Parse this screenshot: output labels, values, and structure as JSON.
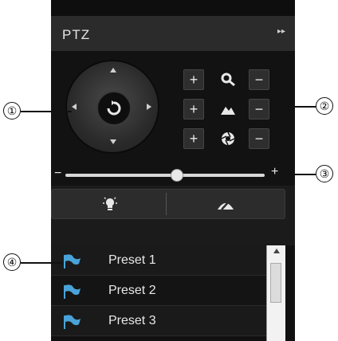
{
  "panel": {
    "title": "PTZ",
    "collapse_symbol": "▸▸"
  },
  "controls": {
    "zoom": {
      "plus": "+",
      "minus": "−",
      "icon": "zoom-magnifier-icon"
    },
    "focus": {
      "plus": "+",
      "minus": "−",
      "icon": "focus-mountain-icon"
    },
    "iris": {
      "plus": "+",
      "minus": "−",
      "icon": "iris-icon"
    }
  },
  "speed_slider": {
    "minus": "−",
    "plus": "+",
    "value_fraction": 0.56
  },
  "buttons": {
    "light_icon": "light-bulb-icon",
    "wiper_icon": "wiper-icon"
  },
  "presets": [
    {
      "label": "Preset 1",
      "icon": "flag-icon"
    },
    {
      "label": "Preset 2",
      "icon": "flag-icon"
    },
    {
      "label": "Preset 3",
      "icon": "flag-icon"
    }
  ],
  "callouts": [
    "①",
    "②",
    "③",
    "④"
  ],
  "colors": {
    "panel_bg": "#1b1b1b",
    "accent_flag": "#4aa3d8",
    "text": "#e8e8e8"
  }
}
